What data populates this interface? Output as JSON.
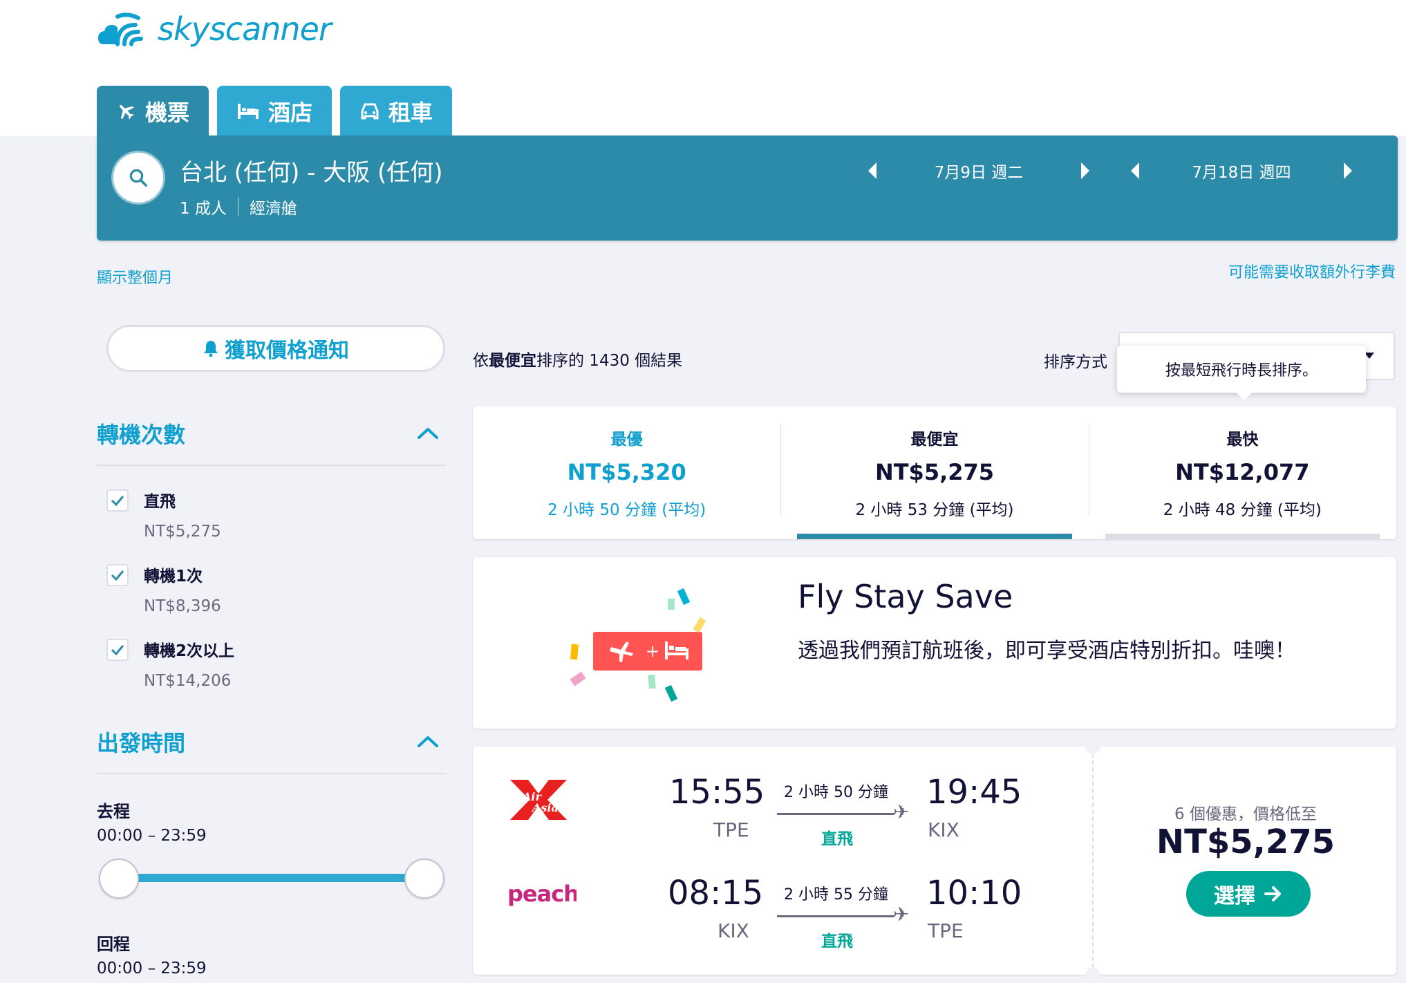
{
  "brand": {
    "name": "skyscanner",
    "color": "#0fa0d0"
  },
  "tabs": [
    {
      "label": "機票",
      "icon": "plane-icon",
      "active": true
    },
    {
      "label": "酒店",
      "icon": "bed-icon",
      "active": false
    },
    {
      "label": "租車",
      "icon": "car-icon",
      "active": false
    }
  ],
  "search": {
    "route": "台北 (任何) - 大阪 (任何)",
    "passengers": "1 成人",
    "cabin": "經濟艙",
    "depart_date": "7月9日 週二",
    "return_date": "7月18日 週四"
  },
  "links": {
    "show_month": "顯示整個月",
    "baggage_fee": "可能需要收取額外行李費"
  },
  "price_alert": {
    "label": "獲取價格通知"
  },
  "filters": {
    "stops": {
      "title": "轉機次數",
      "items": [
        {
          "label": "直飛",
          "price": "NT$5,275",
          "checked": true
        },
        {
          "label": "轉機1次",
          "price": "NT$8,396",
          "checked": true
        },
        {
          "label": "轉機2次以上",
          "price": "NT$14,206",
          "checked": true
        }
      ]
    },
    "times": {
      "title": "出發時間",
      "outbound_label": "去程",
      "outbound_range": "00:00 – 23:59",
      "return_label": "回程",
      "return_range": "00:00 – 23:59"
    }
  },
  "results": {
    "count_prefix": "依",
    "count_bold": "最便宜",
    "count_suffix": "排序的 1430 個結果",
    "sort_label": "排序方式",
    "tooltip": "按最短飛行時長排序。"
  },
  "summary": [
    {
      "title": "最優",
      "price": "NT$5,320",
      "duration": "2 小時 50 分鐘 (平均)",
      "color": "#0fa0d0",
      "selected": false
    },
    {
      "title": "最便宜",
      "price": "NT$5,275",
      "duration": "2 小時 53 分鐘 (平均)",
      "color": "#111236",
      "selected": true
    },
    {
      "title": "最快",
      "price": "NT$12,077",
      "duration": "2 小時 48 分鐘 (平均)",
      "color": "#111236",
      "selected": false
    }
  ],
  "promo": {
    "title": "Fly Stay Save",
    "subtitle": "透過我們預訂航班後，即可享受酒店特別折扣。哇噢！"
  },
  "flight": {
    "legs": [
      {
        "airline": "AirAsia",
        "dep_time": "15:55",
        "dep_code": "TPE",
        "duration": "2 小時 50 分鐘",
        "stops": "直飛",
        "arr_time": "19:45",
        "arr_code": "KIX"
      },
      {
        "airline": "peach",
        "dep_time": "08:15",
        "dep_code": "KIX",
        "duration": "2 小時 55 分鐘",
        "stops": "直飛",
        "arr_time": "10:10",
        "arr_code": "TPE"
      }
    ],
    "deals": "6 個優惠，價格低至",
    "price": "NT$5,275",
    "select_label": "選擇"
  }
}
